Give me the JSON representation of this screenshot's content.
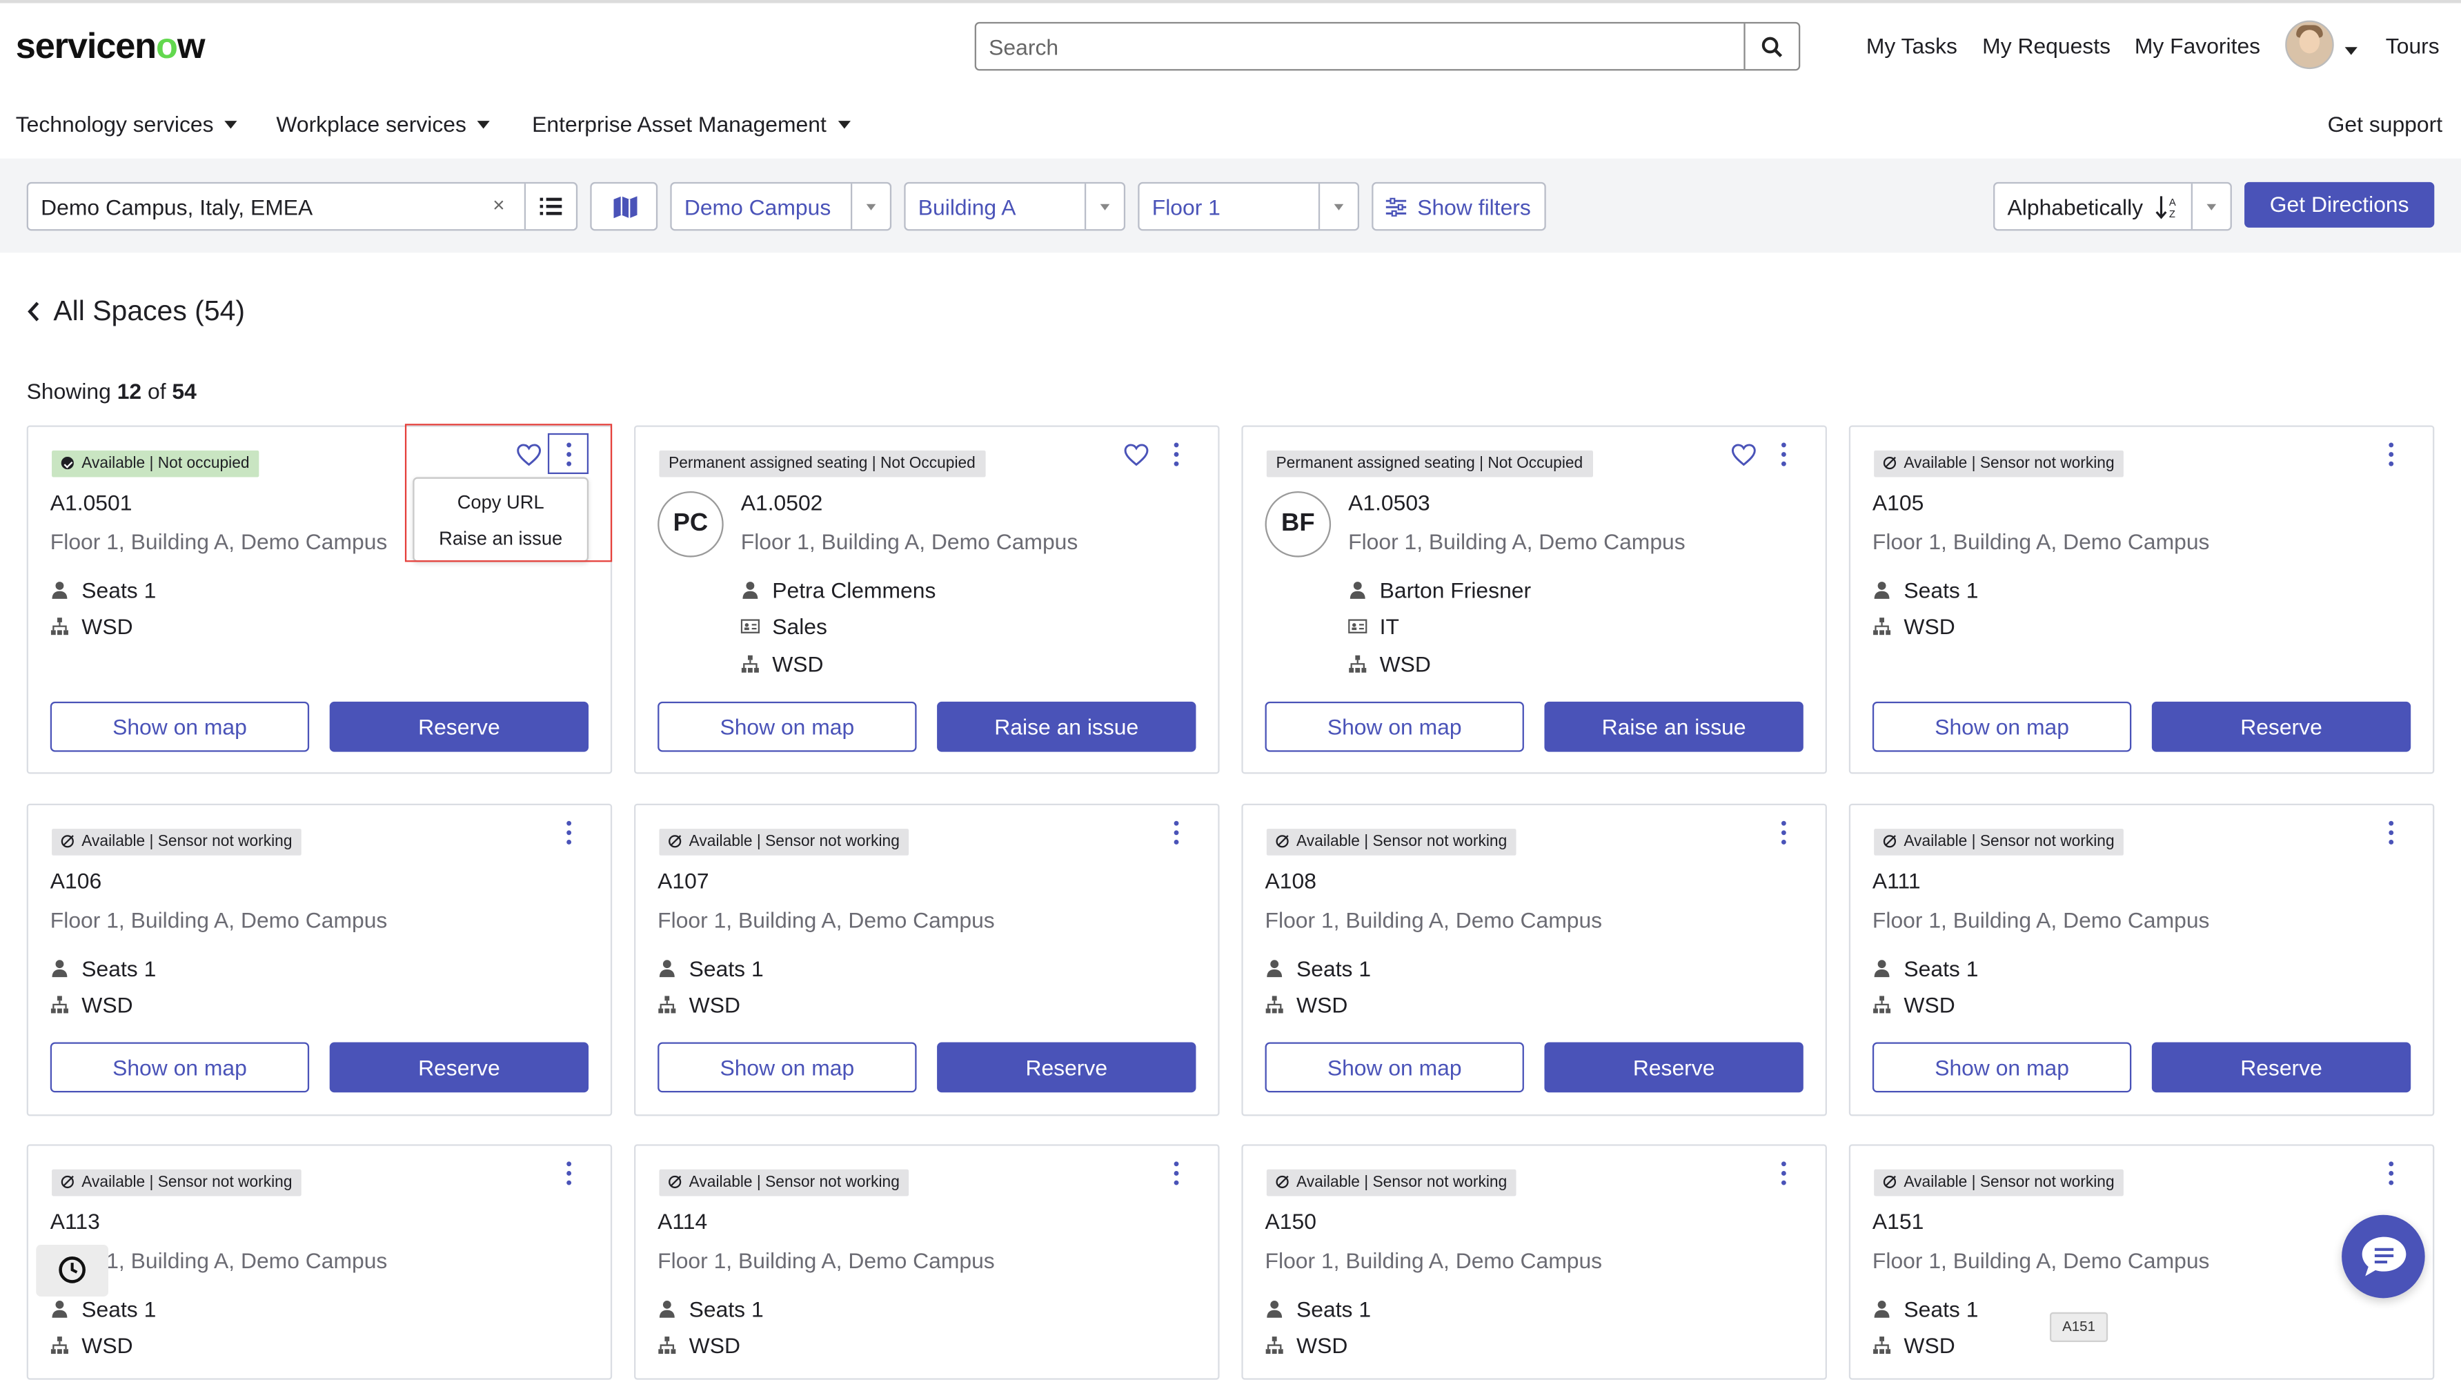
{
  "header": {
    "logo_text_a": "servicen",
    "logo_text_o": "o",
    "logo_text_b": "w",
    "search_placeholder": "Search",
    "links": [
      "My Tasks",
      "My Requests",
      "My Favorites",
      "Tours"
    ],
    "menus": [
      "Technology services",
      "Workplace services",
      "Enterprise Asset Management"
    ],
    "support": "Get support"
  },
  "filters": {
    "location": "Demo Campus, Italy, EMEA",
    "campus": "Demo Campus",
    "building": "Building A",
    "floor": "Floor 1",
    "show_filters": "Show filters",
    "sort": "Alphabetically",
    "directions": "Get Directions"
  },
  "content": {
    "back_title": "All Spaces (54)",
    "showing_prefix": "Showing ",
    "showing_count": "12",
    "showing_mid": " of ",
    "showing_total": "54"
  },
  "popup": {
    "copy_url": "Copy URL",
    "raise_issue": "Raise an issue"
  },
  "cards": [
    {
      "status": "Available | Not occupied",
      "name": "A1.0501",
      "location": "Floor 1, Building A, Demo Campus",
      "seats": "Seats 1",
      "type": "WSD",
      "primary": "Reserve",
      "secondary": "Show on map"
    },
    {
      "status": "Permanent assigned seating | Not Occupied",
      "name": "A1.0502",
      "initials": "PC",
      "location": "Floor 1, Building A, Demo Campus",
      "person": "Petra Clemmens",
      "department": "Sales",
      "type": "WSD",
      "primary": "Raise an issue",
      "secondary": "Show on map"
    },
    {
      "status": "Permanent assigned seating | Not Occupied",
      "name": "A1.0503",
      "initials": "BF",
      "location": "Floor 1, Building A, Demo Campus",
      "person": "Barton Friesner",
      "department": "IT",
      "type": "WSD",
      "primary": "Raise an issue",
      "secondary": "Show on map"
    },
    {
      "status": "Available | Sensor not working",
      "name": "A105",
      "location": "Floor 1, Building A, Demo Campus",
      "seats": "Seats 1",
      "type": "WSD",
      "primary": "Reserve",
      "secondary": "Show on map"
    },
    {
      "status": "Available | Sensor not working",
      "name": "A106",
      "location": "Floor 1, Building A, Demo Campus",
      "seats": "Seats 1",
      "type": "WSD",
      "primary": "Reserve",
      "secondary": "Show on map"
    },
    {
      "status": "Available | Sensor not working",
      "name": "A107",
      "location": "Floor 1, Building A, Demo Campus",
      "seats": "Seats 1",
      "type": "WSD",
      "primary": "Reserve",
      "secondary": "Show on map"
    },
    {
      "status": "Available | Sensor not working",
      "name": "A108",
      "location": "Floor 1, Building A, Demo Campus",
      "seats": "Seats 1",
      "type": "WSD",
      "primary": "Reserve",
      "secondary": "Show on map"
    },
    {
      "status": "Available | Sensor not working",
      "name": "A111",
      "location": "Floor 1, Building A, Demo Campus",
      "seats": "Seats 1",
      "type": "WSD",
      "primary": "Reserve",
      "secondary": "Show on map"
    },
    {
      "status": "Available | Sensor not working",
      "name": "A113",
      "location": "Floor 1, Building A, Demo Campus",
      "seats": "Seats 1",
      "type": "WSD"
    },
    {
      "status": "Available | Sensor not working",
      "name": "A114",
      "location": "Floor 1, Building A, Demo Campus",
      "seats": "Seats 1",
      "type": "WSD"
    },
    {
      "status": "Available | Sensor not working",
      "name": "A150",
      "location": "Floor 1, Building A, Demo Campus",
      "seats": "Seats 1",
      "type": "WSD"
    },
    {
      "status": "Available | Sensor not working",
      "name": "A151",
      "location": "Floor 1, Building A, Demo Campus",
      "seats": "Seats 1",
      "type": "WSD"
    }
  ],
  "tooltip": "A151",
  "colors": {
    "accent": "#4a53b8",
    "available_badge": "#c9e5c2",
    "neutral_badge": "#e3e3e5",
    "highlight": "#e5403b",
    "logo_o": "#62d84e"
  }
}
